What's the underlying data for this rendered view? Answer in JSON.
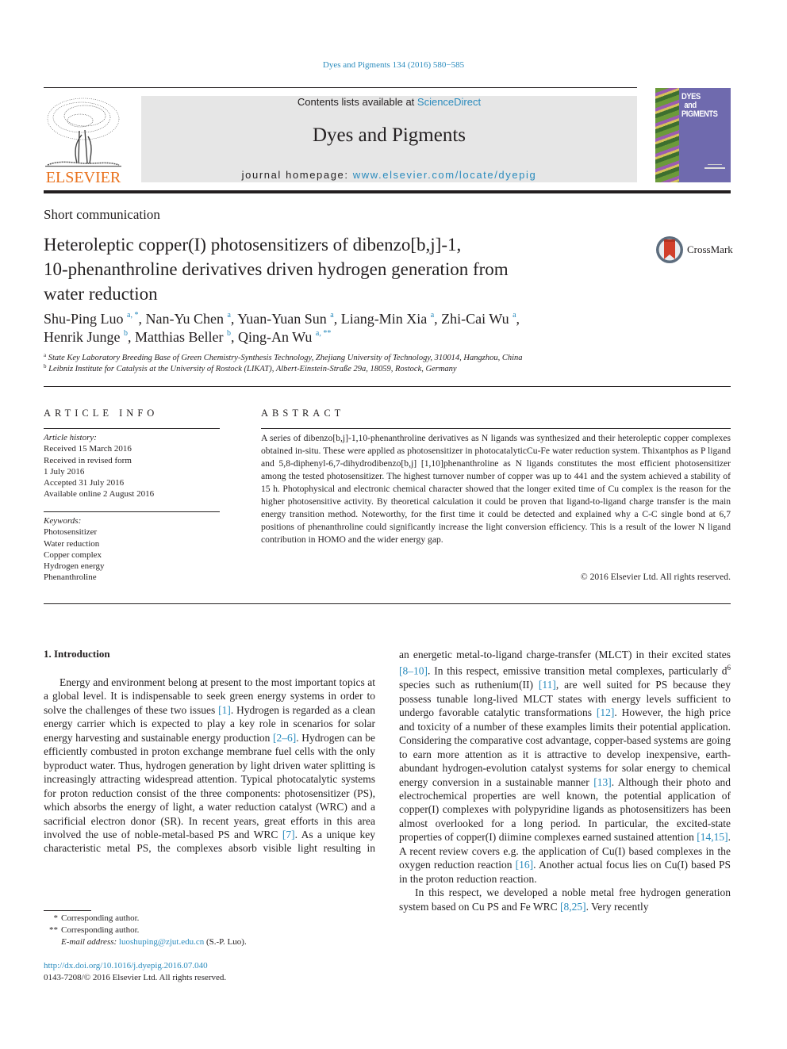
{
  "header": {
    "journal_reference": "Dyes and Pigments 134 (2016) 580−585",
    "contents_prefix": "Contents lists available at ",
    "contents_link": "ScienceDirect",
    "journal_title": "Dyes and Pigments",
    "homepage_prefix": "journal homepage: ",
    "homepage_link": "www.elsevier.com/locate/dyepig",
    "publisher_logo_text": "ELSEVIER",
    "cover_title_lines": [
      "DYES",
      "and",
      "PIGMENTS"
    ],
    "crossmark_label": "CrossMark"
  },
  "article": {
    "type": "Short communication",
    "title": "Heteroleptic copper(I) photosensitizers of dibenzo[b,j]-1,10-phenanthroline derivatives driven hydrogen generation from water reduction",
    "title_lines": [
      "Heteroleptic copper(I) photosensitizers of dibenzo[b,j]-1,",
      "10-phenanthroline derivatives driven hydrogen generation from",
      "water reduction"
    ],
    "authors": [
      {
        "name": "Shu-Ping Luo",
        "sup": "a, *",
        "sep": ", "
      },
      {
        "name": "Nan-Yu Chen",
        "sup": "a",
        "sep": ", "
      },
      {
        "name": "Yuan-Yuan Sun",
        "sup": "a",
        "sep": ", "
      },
      {
        "name": "Liang-Min Xia",
        "sup": "a",
        "sep": ", "
      },
      {
        "name": "Zhi-Cai Wu",
        "sup": "a",
        "sep": ","
      },
      {
        "name": "Henrik Junge",
        "sup": "b",
        "sep": ", "
      },
      {
        "name": "Matthias Beller",
        "sup": "b",
        "sep": ", "
      },
      {
        "name": "Qing-An Wu",
        "sup": "a, **",
        "sep": ""
      }
    ],
    "affiliations": [
      {
        "mark": "a",
        "text": "State Key Laboratory Breeding Base of Green Chemistry-Synthesis Technology, Zhejiang University of Technology, 310014, Hangzhou, China"
      },
      {
        "mark": "b",
        "text": "Leibniz Institute for Catalysis at the University of Rostock (LIKAT), Albert-Einstein-Straße 29a, 18059, Rostock, Germany"
      }
    ]
  },
  "article_info": {
    "heading": "ARTICLE INFO",
    "history_label": "Article history:",
    "history": [
      "Received 15 March 2016",
      "Received in revised form",
      "1 July 2016",
      "Accepted 31 July 2016",
      "Available online 2 August 2016"
    ],
    "keywords_label": "Keywords:",
    "keywords": [
      "Photosensitizer",
      "Water reduction",
      "Copper complex",
      "Hydrogen energy",
      "Phenanthroline"
    ]
  },
  "abstract": {
    "heading": "ABSTRACT",
    "text": "A series of dibenzo[b,j]-1,10-phenanthroline derivatives as N ligands was synthesized and their heteroleptic copper complexes obtained in-situ. These were applied as photosensitizer in photocatalyticCu-Fe water reduction system. Thixantphos as P ligand and 5,8-diphenyl-6,7-dihydrodibenzo[b,j] [1,10]phenanthroline as N ligands constitutes the most efficient photosensitizer among the tested photosensitizer. The highest turnover number of copper was up to 441 and the system achieved a stability of 15 h. Photophysical and electronic chemical character showed that the longer exited time of Cu complex is the reason for the higher photosensitive activity. By theoretical calculation it could be proven that ligand-to-ligand charge transfer is the main energy transition method. Noteworthy, for the first time it could be detected and explained why a C-C single bond at 6,7 positions of phenanthroline could significantly increase the light conversion efficiency. This is a result of the lower N ligand contribution in HOMO and the wider energy gap.",
    "copyright": "© 2016 Elsevier Ltd. All rights reserved."
  },
  "introduction": {
    "heading": "1.  Introduction",
    "paragraphs": [
      [
        {
          "t": "Energy and environment belong at present to the most important topics at a global level. It is indispensable to seek green energy systems in order to solve the challenges of these two issues "
        },
        {
          "c": "[1]"
        },
        {
          "t": ". Hydrogen is regarded as a clean energy carrier which is expected to play a key role in scenarios for solar energy harvesting and sustainable energy production "
        },
        {
          "c": "[2–6]"
        },
        {
          "t": ". Hydrogen can be efficiently combusted in proton exchange membrane fuel cells with the only byproduct water. Thus, hydrogen generation by light driven water splitting is increasingly attracting widespread attention. Typical photocatalytic systems for proton reduction consist of the three components: photosensitizer (PS), which absorbs the energy of light, a water reduction catalyst (WRC) and a sacrificial electron donor (SR). In recent years, great efforts in this area involved the use of noble-metal-based PS and WRC "
        },
        {
          "c": "[7]"
        },
        {
          "t": ". As a unique key characteristic metal PS, the complexes absorb visible light resulting in an energetic metal-to-ligand charge-transfer (MLCT) in their excited states "
        },
        {
          "c": "[8–10]"
        },
        {
          "t": ". In this respect, emissive transition metal complexes, particularly d"
        },
        {
          "s": "6"
        },
        {
          "t": " species such as ruthenium(II) "
        },
        {
          "c": "[11]"
        },
        {
          "t": ", are well suited for PS because they possess tunable long-lived MLCT states with energy levels sufficient to undergo favorable catalytic transformations "
        },
        {
          "c": "[12]"
        },
        {
          "t": ". However, the high price and toxicity of a number of these examples limits their potential application. Considering the comparative cost advantage, copper-based systems are going to earn more attention as it is attractive to develop inexpensive, earth-abundant hydrogen-evolution catalyst systems for solar energy to chemical energy conversion in a sustainable manner "
        },
        {
          "c": "[13]"
        },
        {
          "t": ". Although their photo and electrochemical properties are well known, the potential application of copper(I) complexes with polypyridine ligands as photosensitizers has been almost overlooked for a long period. In particular, the excited-state properties of copper(I) diimine complexes earned sustained attention "
        },
        {
          "c": "[14,15]"
        },
        {
          "t": ". A recent review covers e.g. the application of Cu(I) based complexes in the oxygen reduction reaction "
        },
        {
          "c": "[16]"
        },
        {
          "t": ". Another actual focus lies on Cu(I) based PS in the proton reduction reaction."
        }
      ],
      [
        {
          "t": "In this respect, we developed a noble metal free hydrogen generation system based on Cu PS and Fe WRC "
        },
        {
          "c": "[8,25]"
        },
        {
          "t": ". Very recently"
        }
      ]
    ],
    "left_column_lines": [
      "Energy and environment belong at present to the most impor-",
      "tant topics at a global level. It is indispensable to seek green energy",
      "systems in order to solve the challenges of these two issues [1].",
      "Hydrogen is regarded as a clean energy carrier which is expected to",
      "play a key role in scenarios for solar energy harvesting and sus-",
      "tainable energy production [2–6]. Hydrogen can be efficiently",
      "combusted in proton exchange membrane fuel cells with the only",
      "byproduct water. Thus, hydrogen generation by light driven water",
      "splitting is increasingly attracting widespread attention. Typical",
      "photocatalytic systems for proton reduction consist of the three",
      "components: photosensitizer (PS), which absorbs the energy of",
      "light, a water reduction catalyst (WRC) and a sacrificial electron",
      "donor (SR). In recent years, great efforts in this area involved the",
      "use of noble-metal-based PS and WRC [7]. As a unique key char-",
      "acteristic metal PS, the complexes absorb visible light resulting in"
    ]
  },
  "footnotes": {
    "items": [
      {
        "mark": "*",
        "text": "Corresponding author."
      },
      {
        "mark": "**",
        "text": "Corresponding author."
      }
    ],
    "email_label": "E-mail address: ",
    "email": "luoshuping@zjut.edu.cn",
    "email_suffix": " (S.-P. Luo).",
    "doi": "http://dx.doi.org/10.1016/j.dyepig.2016.07.040",
    "issn_line": "0143-7208/© 2016 Elsevier Ltd. All rights reserved."
  },
  "colors": {
    "link": "#2a8bbd",
    "text": "#231f20",
    "masthead_bg": "#e6e6e6",
    "elsevier_orange": "#e9711c",
    "cover_purple": "#6f6aae"
  }
}
